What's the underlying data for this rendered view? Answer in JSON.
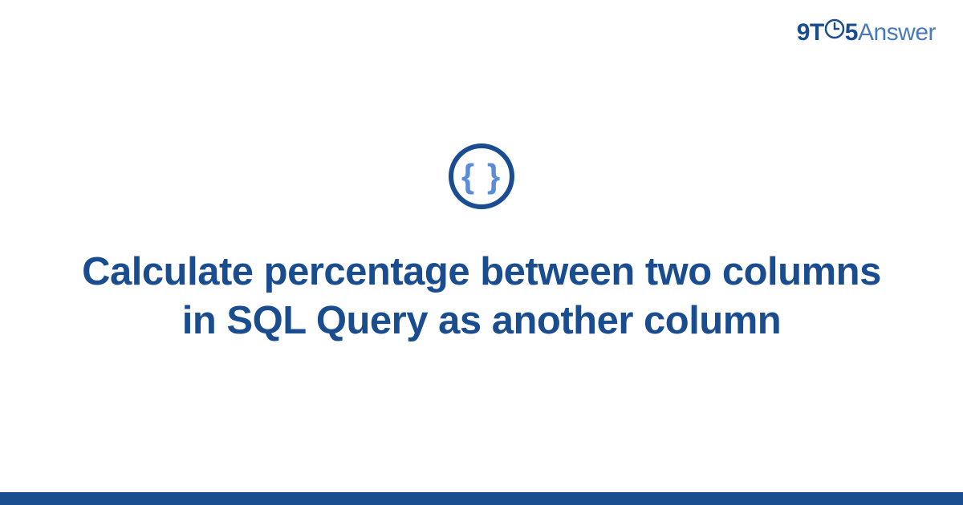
{
  "logo": {
    "part1": "9T",
    "part2": "5",
    "part3": "Answer"
  },
  "icon": {
    "name": "curly-braces",
    "glyph": "{ }"
  },
  "title": "Calculate percentage between two columns in SQL Query as another column",
  "colors": {
    "primary": "#1a4d8f",
    "secondary": "#5b8dd6",
    "tertiary": "#4a7bb8"
  }
}
